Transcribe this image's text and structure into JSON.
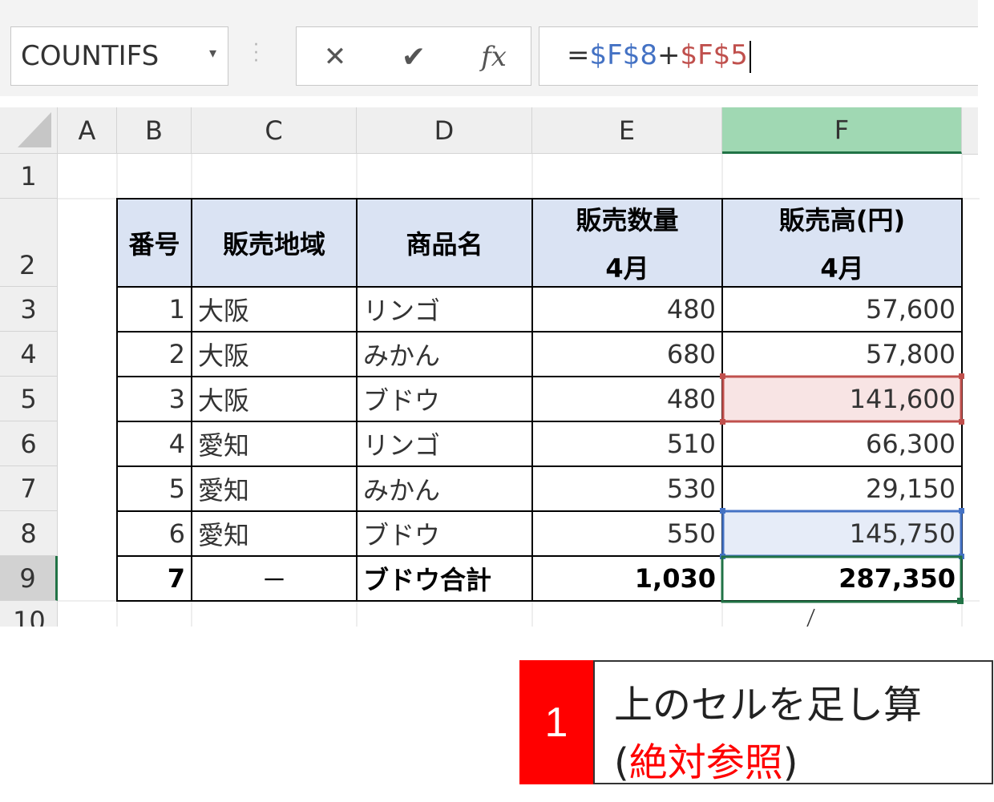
{
  "name_box": {
    "value": "COUNTIFS",
    "dropdown": "▾"
  },
  "formula_bar": {
    "cancel_icon": "✕",
    "enter_icon": "✔",
    "fx_label": "fx",
    "formula_eq": "=",
    "ref1": "$F$8",
    "op": "+",
    "ref2": "$F$5"
  },
  "columns": [
    "A",
    "B",
    "C",
    "D",
    "E",
    "F"
  ],
  "rows": [
    "1",
    "2",
    "3",
    "4",
    "5",
    "6",
    "7",
    "8",
    "9",
    "10"
  ],
  "table": {
    "headers": {
      "no": "番号",
      "region": "販売地域",
      "product": "商品名",
      "qty": "販売数量",
      "qty_sub": "4月",
      "sales": "販売高(円)",
      "sales_sub": "4月"
    },
    "rows": [
      {
        "no": "1",
        "region": "大阪",
        "product": "リンゴ",
        "qty": "480",
        "sales": "57,600"
      },
      {
        "no": "2",
        "region": "大阪",
        "product": "みかん",
        "qty": "680",
        "sales": "57,800"
      },
      {
        "no": "3",
        "region": "大阪",
        "product": "ブドウ",
        "qty": "480",
        "sales": "141,600"
      },
      {
        "no": "4",
        "region": "愛知",
        "product": "リンゴ",
        "qty": "510",
        "sales": "66,300"
      },
      {
        "no": "5",
        "region": "愛知",
        "product": "みかん",
        "qty": "530",
        "sales": "29,150"
      },
      {
        "no": "6",
        "region": "愛知",
        "product": "ブドウ",
        "qty": "550",
        "sales": "145,750"
      }
    ],
    "total": {
      "no": "7",
      "region": "－",
      "product": "ブドウ合計",
      "qty": "1,030",
      "sales": "287,350"
    }
  },
  "callout": {
    "number": "1",
    "line1": "上のセルを足し算",
    "paren_open": "(",
    "highlight": "絶対参照",
    "paren_close": ")"
  },
  "colors": {
    "ref1": "#4472c4",
    "ref2": "#c0504d",
    "selected": "#217346",
    "header_fill": "#dae3f3",
    "callout_red": "#ff0000"
  }
}
